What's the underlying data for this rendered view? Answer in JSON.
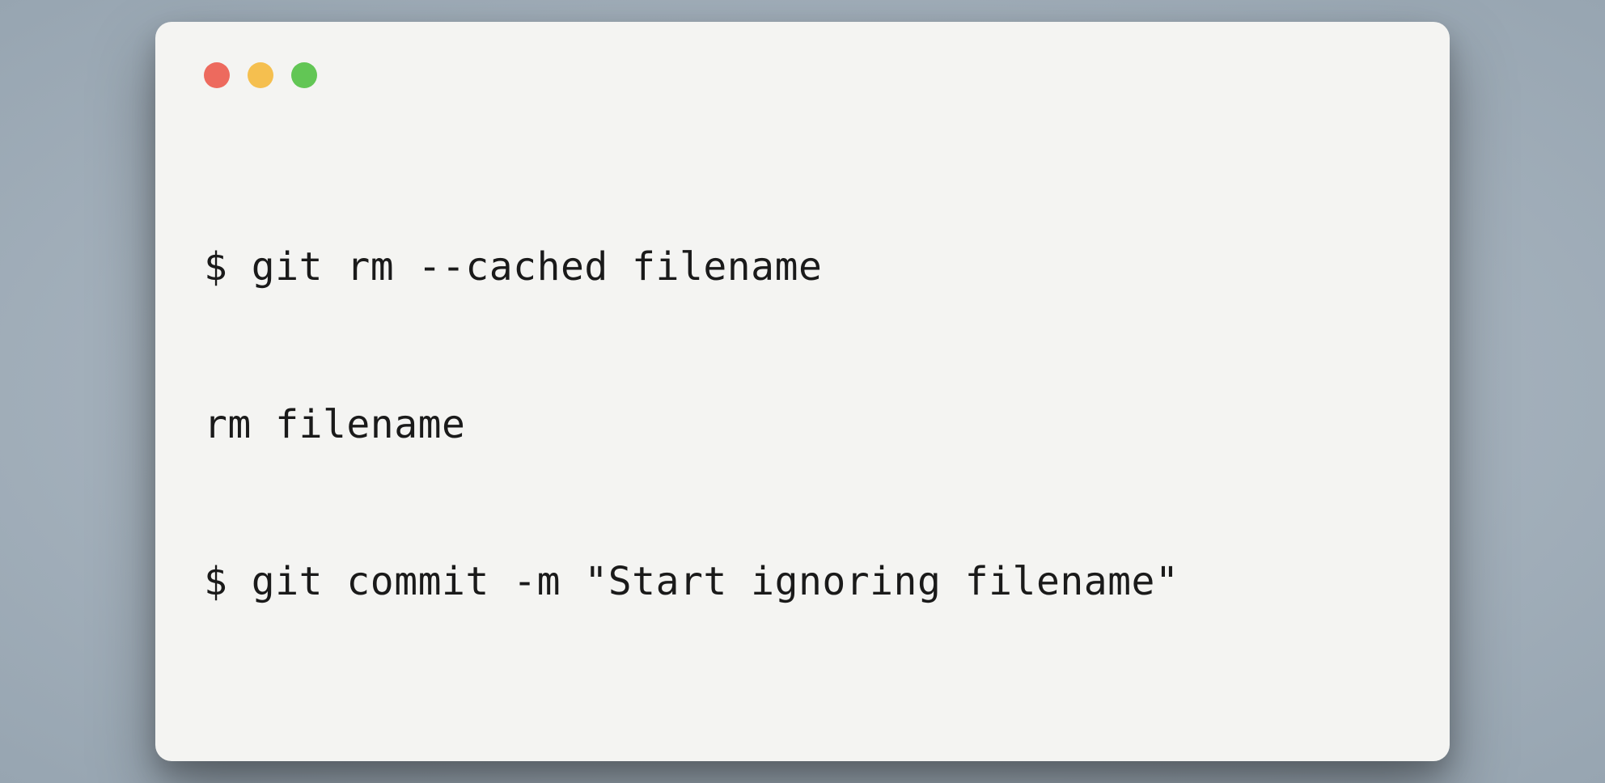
{
  "terminal": {
    "lines": [
      "$ git rm --cached filename",
      "rm filename",
      "$ git commit -m \"Start ignoring filename\""
    ]
  },
  "colors": {
    "red": "#ed6a5e",
    "yellow": "#f5bf4f",
    "green": "#62c655",
    "window_bg": "#f4f4f2",
    "page_bg": "#97a5b1"
  }
}
